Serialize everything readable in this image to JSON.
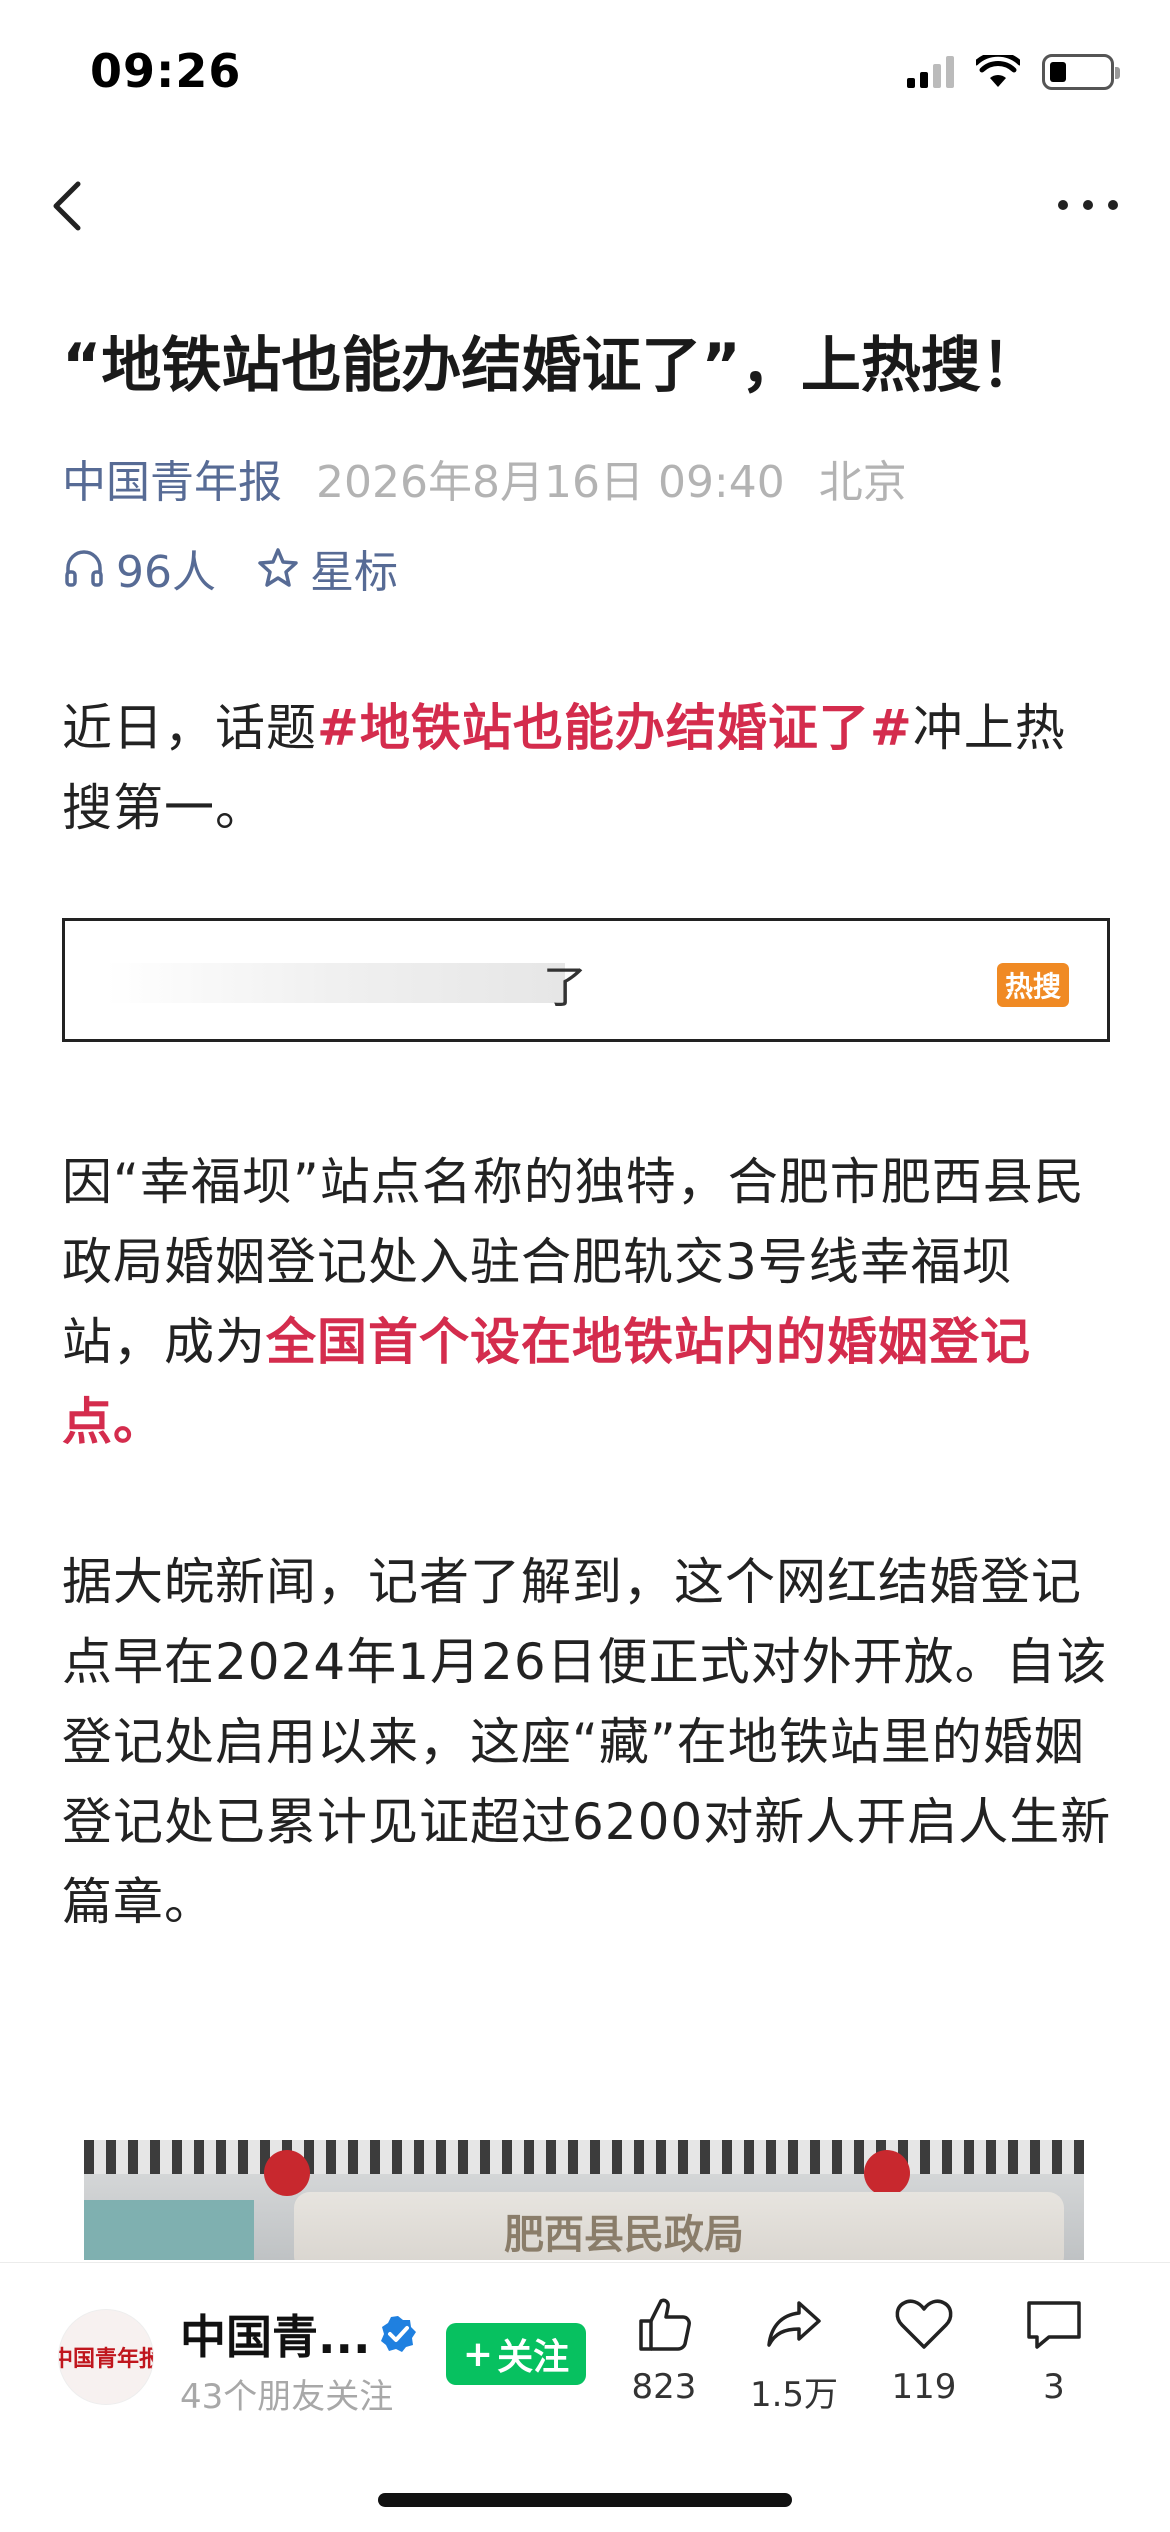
{
  "status_bar": {
    "time": "09:26"
  },
  "article": {
    "title": "“地铁站也能办结婚证了”，上热搜！",
    "source": "中国青年报",
    "date": "2026年8月16日 09:40",
    "location": "北京",
    "listeners": "96人",
    "star_label": "星标",
    "p1_pre": "近日，话题",
    "p1_highlight": "#地铁站也能办结婚证了#",
    "p1_post": "冲上热搜第一。",
    "hot_search_text": "了",
    "hot_badge": "热搜",
    "p2_pre": "因“幸福坝”站点名称的独特，合肥市肥西县民政局婚姻登记处入驻合肥轨交3号线幸福坝站，成为",
    "p2_highlight": "全国首个设在地铁站内的婚姻登记点。",
    "p3": "据大皖新闻，记者了解到，这个网红结婚登记点早在2024年1月26日便正式对外开放。自该登记处启用以来，这座“藏”在地铁站里的婚姻登记处已累计见证超过6200对新人开启人生新篇章。",
    "photo_sign": "肥西县民政局"
  },
  "bottom_bar": {
    "avatar_text": "中国青年报",
    "account_name": "中国青...",
    "followers": "43个朋友关注",
    "follow_label": "关注",
    "like_count": "823",
    "share_count": "1.5万",
    "favorite_count": "119",
    "comment_count": "3"
  },
  "colors": {
    "accent_red": "#d42c4d",
    "link_blue": "#576b95",
    "follow_green": "#07c160",
    "badge_orange": "#f08a24"
  }
}
